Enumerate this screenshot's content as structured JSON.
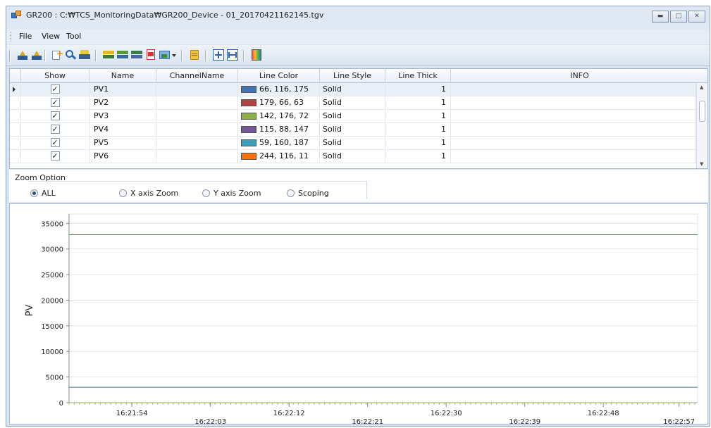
{
  "window": {
    "title": "GR200 : C:₩TCS_MonitoringData₩GR200_Device - 01_20170421162145.tgv",
    "buttons": [
      "minimize",
      "maximize",
      "close"
    ]
  },
  "menu": {
    "items": [
      "File",
      "View",
      "Tool"
    ]
  },
  "toolbar": {
    "icons": [
      "open-icon",
      "open-m-icon",
      "add-icon",
      "search-icon",
      "print-icon",
      "channel-set-icon",
      "channel-export-icon",
      "channel-import-icon",
      "pdf-icon",
      "image-dropdown-icon",
      "list-icon",
      "zoom-fit-icon",
      "horizontal-fit-icon",
      "color-palette-icon"
    ]
  },
  "grid": {
    "columns": [
      "Show",
      "Name",
      "ChannelName",
      "Line Color",
      "Line Style",
      "Line Thick",
      "INFO"
    ],
    "rows": [
      {
        "show": true,
        "name": "PV1",
        "channel": "",
        "color_text": "66, 116, 175",
        "color": "#4274af",
        "style": "Solid",
        "thick": "1",
        "info": ""
      },
      {
        "show": true,
        "name": "PV2",
        "channel": "",
        "color_text": "179, 66, 63",
        "color": "#b3423f",
        "style": "Solid",
        "thick": "1",
        "info": ""
      },
      {
        "show": true,
        "name": "PV3",
        "channel": "",
        "color_text": "142, 176, 72",
        "color": "#8eb048",
        "style": "Solid",
        "thick": "1",
        "info": ""
      },
      {
        "show": true,
        "name": "PV4",
        "channel": "",
        "color_text": "115, 88, 147",
        "color": "#735893",
        "style": "Solid",
        "thick": "1",
        "info": ""
      },
      {
        "show": true,
        "name": "PV5",
        "channel": "",
        "color_text": "59, 160, 187",
        "color": "#3ba0bb",
        "style": "Solid",
        "thick": "1",
        "info": ""
      },
      {
        "show": true,
        "name": "PV6",
        "channel": "",
        "color_text": "244, 116, 11",
        "color": "#f4740b",
        "style": "Solid",
        "thick": "1",
        "info": ""
      }
    ]
  },
  "zoom": {
    "label": "Zoom Option",
    "options": [
      {
        "label": "ALL",
        "selected": true
      },
      {
        "label": "X axis Zoom",
        "selected": false
      },
      {
        "label": "Y axis Zoom",
        "selected": false
      },
      {
        "label": "Scoping",
        "selected": false
      }
    ]
  },
  "chart_data": {
    "type": "line",
    "ylabel": "PV",
    "xlabel": "",
    "ylim": [
      0,
      36000
    ],
    "yticks": [
      0,
      5000,
      10000,
      15000,
      20000,
      25000,
      30000,
      35000
    ],
    "xticks_top": [
      "16:21:54",
      "16:22:12",
      "16:22:30",
      "16:22:48"
    ],
    "xticks_bottom": [
      "16:22:03",
      "16:22:21",
      "16:22:39",
      "16:22:57"
    ],
    "grid": true,
    "series": [
      {
        "color": "#b3423f",
        "values": [
          32767,
          32767
        ]
      },
      {
        "color": "#4274af",
        "values": [
          3000,
          3000
        ]
      },
      {
        "color": "#8eb048",
        "values": [
          0,
          0
        ]
      }
    ]
  }
}
